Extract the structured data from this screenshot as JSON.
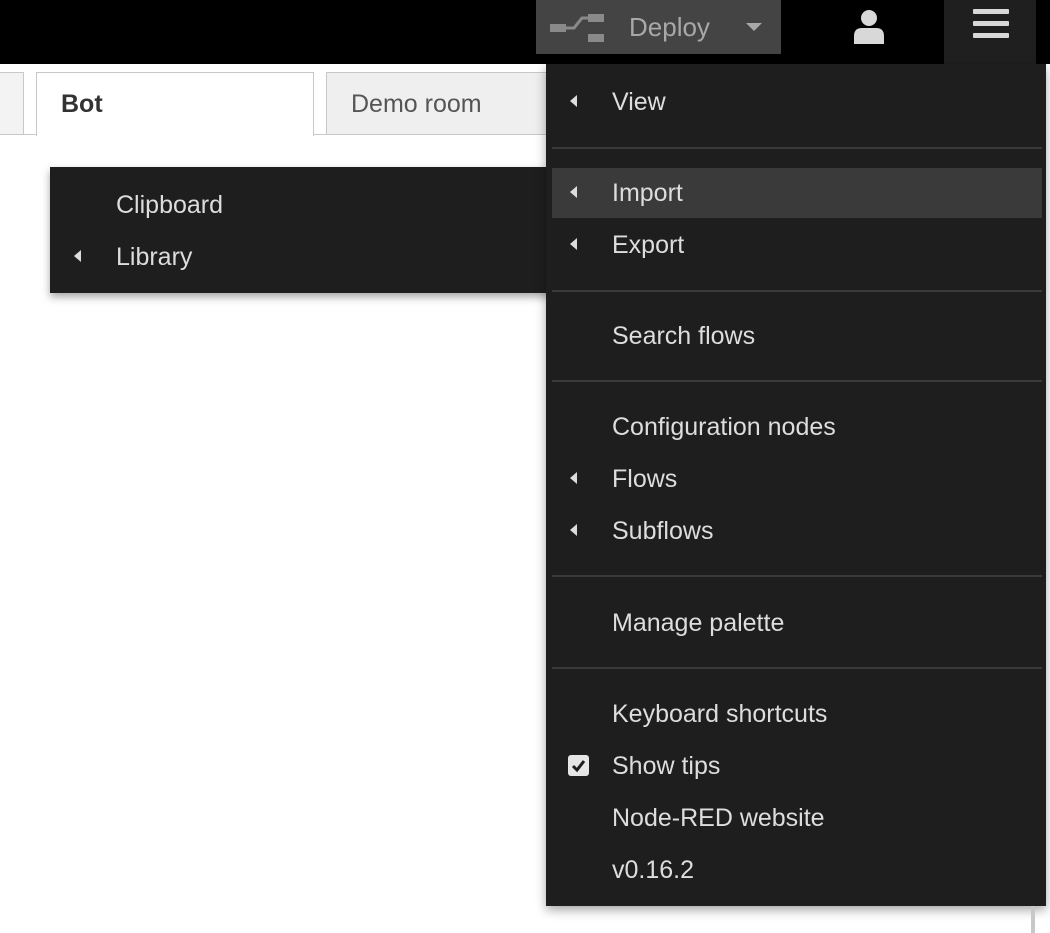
{
  "header": {
    "deploy_label": "Deploy",
    "deploy_icon": "deploy-flow-icon",
    "user_icon": "user-icon",
    "menu_icon": "hamburger-menu-icon"
  },
  "tabs": [
    {
      "label": ""
    },
    {
      "label": "Bot",
      "active": true
    },
    {
      "label": "Demo room"
    }
  ],
  "submenu": {
    "items": [
      {
        "label": "Clipboard",
        "has_submenu": false
      },
      {
        "label": "Library",
        "has_submenu": true
      }
    ]
  },
  "menu": {
    "items": [
      {
        "label": "View",
        "has_submenu": true
      },
      {
        "label": "Import",
        "has_submenu": true,
        "active": true
      },
      {
        "label": "Export",
        "has_submenu": true
      },
      {
        "label": "Search flows"
      },
      {
        "label": "Configuration nodes"
      },
      {
        "label": "Flows",
        "has_submenu": true
      },
      {
        "label": "Subflows",
        "has_submenu": true
      },
      {
        "label": "Manage palette"
      },
      {
        "label": "Keyboard shortcuts"
      },
      {
        "label": "Show tips",
        "checked": true
      },
      {
        "label": "Node-RED website"
      },
      {
        "label": "v0.16.2"
      }
    ]
  },
  "colors": {
    "header_bg": "#000000",
    "menu_bg": "#1e1e1e",
    "menu_text": "#dddddd",
    "active_item_bg": "#3a3a3a",
    "deploy_bg": "#444444"
  }
}
